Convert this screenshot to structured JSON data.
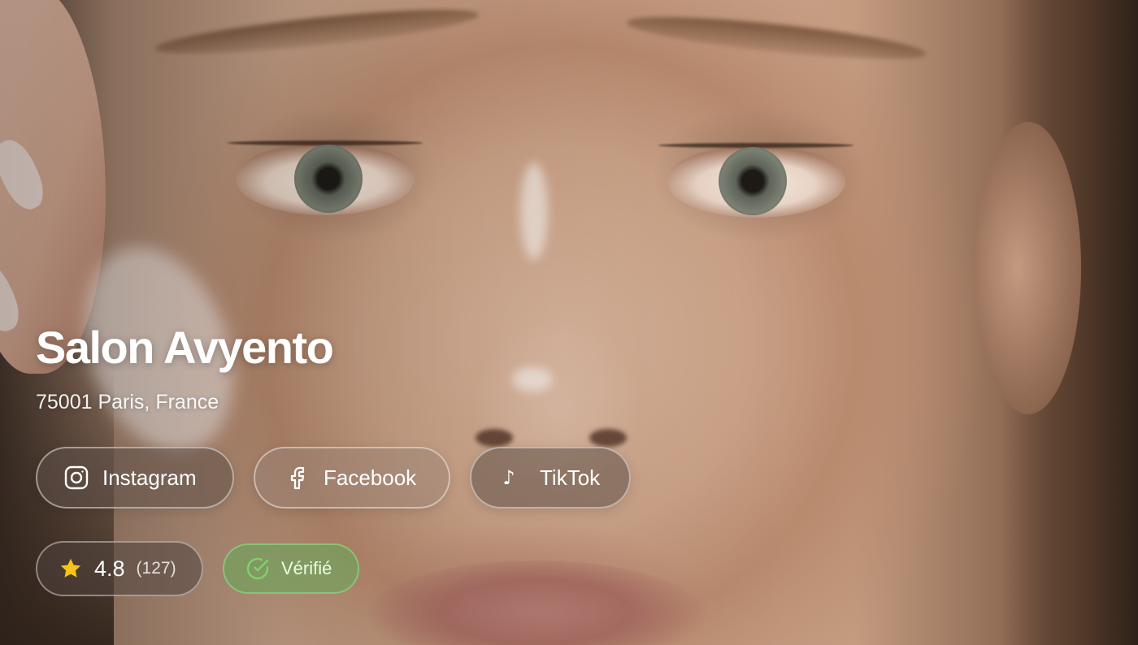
{
  "salon": {
    "name": "Salon Avyento",
    "address": "75001 Paris, France"
  },
  "socials": [
    {
      "label": "Instagram",
      "icon": "instagram-icon"
    },
    {
      "label": "Facebook",
      "icon": "facebook-icon"
    },
    {
      "label": "TikTok",
      "icon": "tiktok-icon"
    }
  ],
  "rating": {
    "value": "4.8",
    "count": "(127)",
    "icon": "star-icon",
    "star_color": "#F5C518"
  },
  "verified": {
    "label": "Vérifié",
    "icon": "check-circle-icon",
    "color": "#7FD26B"
  }
}
